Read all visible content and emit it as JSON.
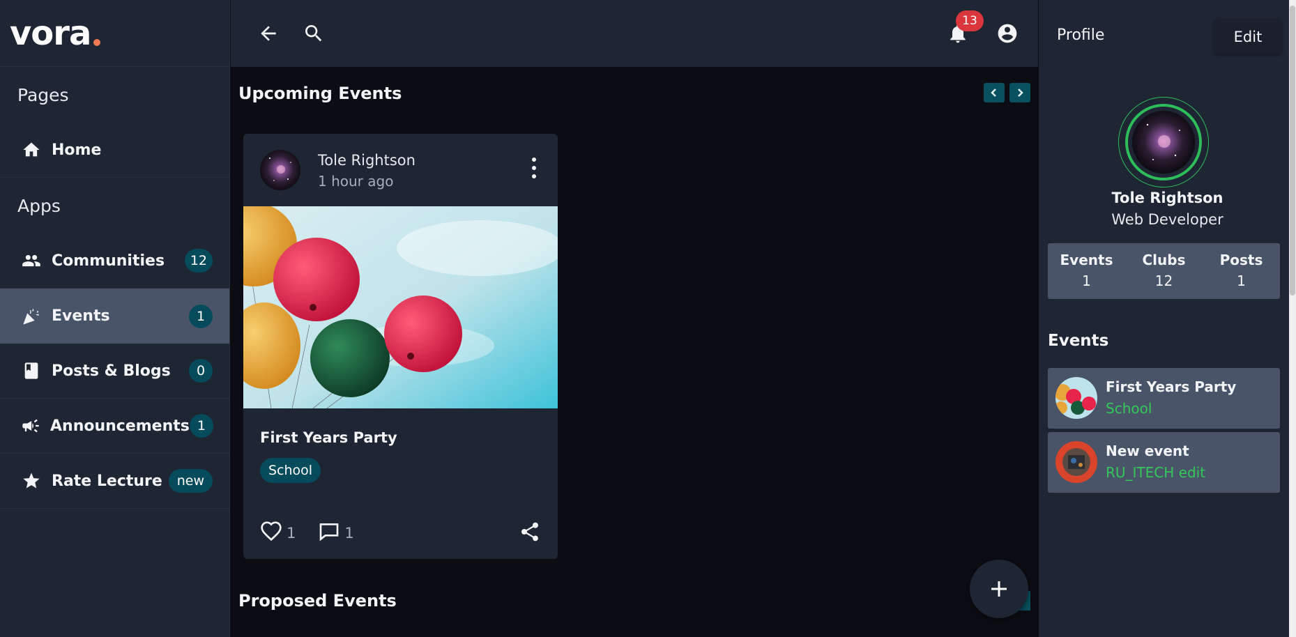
{
  "brand": {
    "name": "vora",
    "dot_color": "#f07b52"
  },
  "colors": {
    "accent_teal": "#064b5c",
    "active_item_bg": "#4a5468",
    "notification": "#d9363e",
    "online_ring": "#2dbd5b"
  },
  "sidebar": {
    "pages_title": "Pages",
    "apps_title": "Apps",
    "pages": [
      {
        "icon": "home-icon",
        "label": "Home"
      }
    ],
    "apps": [
      {
        "icon": "people-icon",
        "label": "Communities",
        "badge": "12"
      },
      {
        "icon": "party-popper-icon",
        "label": "Events",
        "badge": "1",
        "active": true
      },
      {
        "icon": "book-icon",
        "label": "Posts & Blogs",
        "badge": "0"
      },
      {
        "icon": "megaphone-icon",
        "label": "Announcements",
        "badge": "1"
      },
      {
        "icon": "star-icon",
        "label": "Rate Lecture",
        "badge": "new"
      }
    ]
  },
  "topbar": {
    "notifications_count": "13"
  },
  "main": {
    "upcoming_title": "Upcoming Events",
    "proposed_title": "Proposed Events",
    "card": {
      "author": "Tole Rightson",
      "time": "1 hour ago",
      "title": "First Years Party",
      "tag": "School",
      "likes": "1",
      "comments": "1"
    }
  },
  "profile": {
    "title": "Profile",
    "edit_label": "Edit",
    "name": "Tole Rightson",
    "role": "Web Developer",
    "stats": [
      {
        "label": "Events",
        "value": "1"
      },
      {
        "label": "Clubs",
        "value": "12"
      },
      {
        "label": "Posts",
        "value": "1"
      }
    ],
    "events_title": "Events",
    "events": [
      {
        "name": "First Years Party",
        "sub": "School"
      },
      {
        "name": "New event",
        "sub": "RU_ITECH edit"
      }
    ]
  }
}
